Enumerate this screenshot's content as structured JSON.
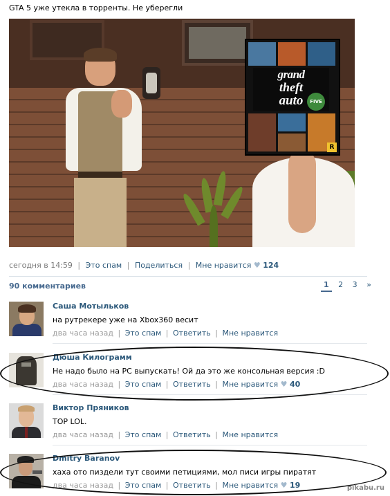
{
  "post": {
    "text": "GTA 5 уже утекла в торренты. Не уберегли",
    "cover": {
      "line1": "grand",
      "line2": "theft",
      "line3": "auto",
      "badge": "FIVE",
      "publisher_mark": "R"
    },
    "meta": {
      "date": "сегодня в 14:59",
      "spam": "Это спам",
      "share": "Поделиться",
      "like": "Мне нравится",
      "likes": "124"
    }
  },
  "comments_header": {
    "count_label": "90 комментариев",
    "pages": [
      "1",
      "2",
      "3",
      "»"
    ],
    "current_page": "1"
  },
  "comments": [
    {
      "author": "Саша Мотыльков",
      "text": "на рутрекере уже на Xbox360 весит",
      "time": "два часа назад",
      "spam": "Это спам",
      "reply": "Ответить",
      "like": "Мне нравится",
      "likes": ""
    },
    {
      "author": "Дюша Килограмм",
      "text": "Не надо было на PC выпускать! Ой да это же консольная версия :D",
      "time": "два часа назад",
      "spam": "Это спам",
      "reply": "Ответить",
      "like": "Мне нравится",
      "likes": "40"
    },
    {
      "author": "Виктор Пряников",
      "text": "TOP LOL.",
      "time": "два часа назад",
      "spam": "Это спам",
      "reply": "Ответить",
      "like": "Мне нравится",
      "likes": ""
    },
    {
      "author": "Dmitry Baranov",
      "text": "хаха ото пиздели тут своими петициями, мол писи игры пиратят",
      "time": "два часа назад",
      "spam": "Это спам",
      "reply": "Ответить",
      "like": "Мне нравится",
      "likes": "19"
    }
  ],
  "watermark": "pikabu.ru",
  "colors": {
    "link": "#2b587a",
    "header": "#45688e",
    "muted": "#999999",
    "heart": "#a3b9cd"
  },
  "icons": {
    "like": "heart-icon"
  }
}
